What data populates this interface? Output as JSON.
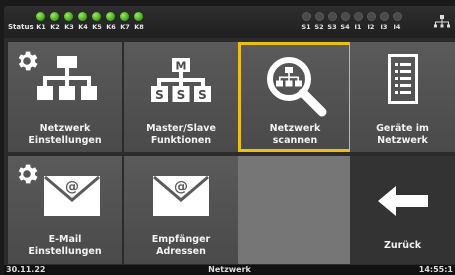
{
  "status": {
    "label": "Status",
    "k_leds": [
      "K1",
      "K2",
      "K3",
      "K4",
      "K5",
      "K6",
      "K7",
      "K8"
    ],
    "s_leds": [
      "S1",
      "S2",
      "S3",
      "S4",
      "I1",
      "I2",
      "I3",
      "I4"
    ],
    "k_color": "#5bc428",
    "s_color": "#4a4a4a"
  },
  "tiles": {
    "netzwerk_einstellungen": {
      "line1": "Netzwerk",
      "line2": "Einstellungen",
      "icon": "network-settings-icon"
    },
    "master_slave": {
      "line1": "Master/Slave",
      "line2": "Funktionen",
      "icon": "master-slave-icon",
      "m": "M",
      "s": "S"
    },
    "netzwerk_scannen": {
      "line1": "Netzwerk",
      "line2": "scannen",
      "icon": "network-scan-icon"
    },
    "geraete": {
      "line1": "Geräte im",
      "line2": "Netzwerk",
      "icon": "device-list-icon"
    },
    "email": {
      "line1": "E-Mail",
      "line2": "Einstellungen",
      "icon": "email-settings-icon",
      "at": "@"
    },
    "empfaenger": {
      "line1": "Empfänger",
      "line2": "Adressen",
      "icon": "email-recipients-icon",
      "at": "@"
    },
    "zurueck": {
      "label": "Zurück",
      "icon": "arrow-left-icon"
    }
  },
  "accent": "#e8c114",
  "footer": {
    "date": "30.11.22",
    "title": "Netzwerk",
    "time": "14:55:1"
  }
}
